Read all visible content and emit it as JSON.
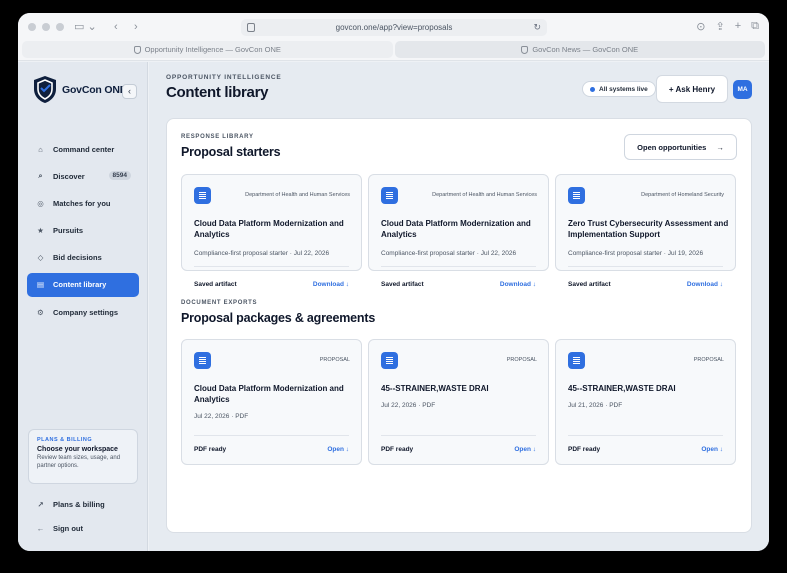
{
  "browser": {
    "url": "govcon.one/app?view=proposals",
    "tabs": [
      {
        "label": "Opportunity Intelligence — GovCon ONE",
        "active": true
      },
      {
        "label": "GovCon News — GovCon ONE",
        "active": false
      }
    ]
  },
  "sidebar": {
    "brand": "GovCon ONE",
    "collapse_icon": "‹",
    "items": [
      {
        "label": "Command center",
        "icon": "⌂"
      },
      {
        "label": "Discover",
        "icon": "⌕",
        "badge": "8594"
      },
      {
        "label": "Matches for you",
        "icon": "◎"
      },
      {
        "label": "Pursuits",
        "icon": "★"
      },
      {
        "label": "Bid decisions",
        "icon": "◇"
      },
      {
        "label": "Content library",
        "icon": "▤",
        "active": true
      },
      {
        "label": "Company settings",
        "icon": "⚙"
      }
    ],
    "plan_card": {
      "eyebrow": "PLANS & BILLING",
      "title": "Choose your workspace",
      "desc": "Review team sizes, usage, and partner options."
    },
    "footer": [
      {
        "label": "Plans & billing",
        "icon": "↗"
      },
      {
        "label": "Sign out",
        "icon": "←"
      }
    ]
  },
  "header": {
    "eyebrow": "OPPORTUNITY INTELLIGENCE",
    "title": "Content library",
    "status": "All systems live",
    "ask_button": "+ Ask Henry",
    "avatar": "MA"
  },
  "response_library": {
    "eyebrow": "RESPONSE LIBRARY",
    "title": "Proposal starters",
    "open_button": "Open opportunities",
    "open_button_icon": "→",
    "cards": [
      {
        "agency": "Department of Health and Human Services",
        "title": "Cloud Data Platform Modernization and Analytics",
        "meta": "Compliance-first proposal starter · Jul 22, 2026",
        "state": "Saved artifact",
        "action": "Download ↓"
      },
      {
        "agency": "Department of Health and Human Services",
        "title": "Cloud Data Platform Modernization and Analytics",
        "meta": "Compliance-first proposal starter · Jul 22, 2026",
        "state": "Saved artifact",
        "action": "Download ↓"
      },
      {
        "agency": "Department of Homeland Security",
        "title": "Zero Trust Cybersecurity Assessment and Implementation Support",
        "meta": "Compliance-first proposal starter · Jul 19, 2026",
        "state": "Saved artifact",
        "action": "Download ↓"
      }
    ]
  },
  "document_exports": {
    "eyebrow": "DOCUMENT EXPORTS",
    "title": "Proposal packages & agreements",
    "cards": [
      {
        "tag": "PROPOSAL",
        "title": "Cloud Data Platform Modernization and Analytics",
        "meta": "Jul 22, 2026 · PDF",
        "state": "PDF ready",
        "action": "Open ↓"
      },
      {
        "tag": "PROPOSAL",
        "title": "45--STRAINER,WASTE DRAI",
        "meta": "Jul 22, 2026 · PDF",
        "state": "PDF ready",
        "action": "Open ↓"
      },
      {
        "tag": "PROPOSAL",
        "title": "45--STRAINER,WASTE DRAI",
        "meta": "Jul 21, 2026 · PDF",
        "state": "PDF ready",
        "action": "Open ↓"
      }
    ]
  },
  "colors": {
    "accent": "#2f6fe0",
    "navy": "#0f1f3d"
  }
}
